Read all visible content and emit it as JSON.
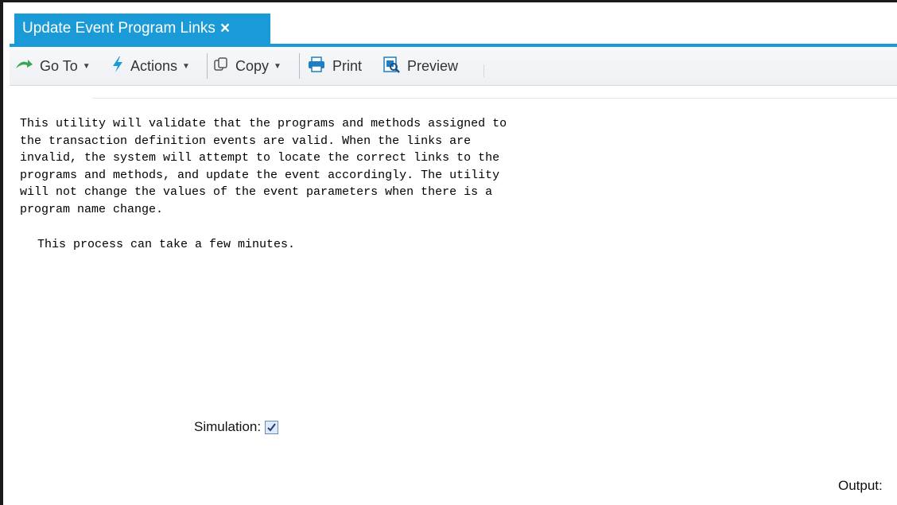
{
  "tab": {
    "title": "Update Event Program Links",
    "close_glyph": "×"
  },
  "toolbar": {
    "goto": {
      "label": "Go To",
      "icon": "goto-arrow-icon"
    },
    "actions": {
      "label": "Actions",
      "icon": "lightning-icon"
    },
    "copy": {
      "label": "Copy",
      "icon": "copy-icon"
    },
    "print": {
      "label": "Print",
      "icon": "printer-icon"
    },
    "preview": {
      "label": "Preview",
      "icon": "preview-icon"
    }
  },
  "content": {
    "description": "This utility will validate that the programs and methods assigned to\nthe transaction definition events are valid. When the links are\ninvalid, the system will attempt to locate the correct links to the\nprograms and methods, and update the event accordingly. The utility\nwill not change the values of the event parameters when there is a\nprogram name change.",
    "note": "This process can take a few minutes."
  },
  "form": {
    "simulation_label": "Simulation:",
    "simulation_checked": true,
    "output_label": "Output:"
  },
  "colors": {
    "accent": "#1a9bd7",
    "goto_icon": "#3aa655",
    "actions_icon": "#1a9bd7",
    "print_icon": "#1f7fc4"
  }
}
